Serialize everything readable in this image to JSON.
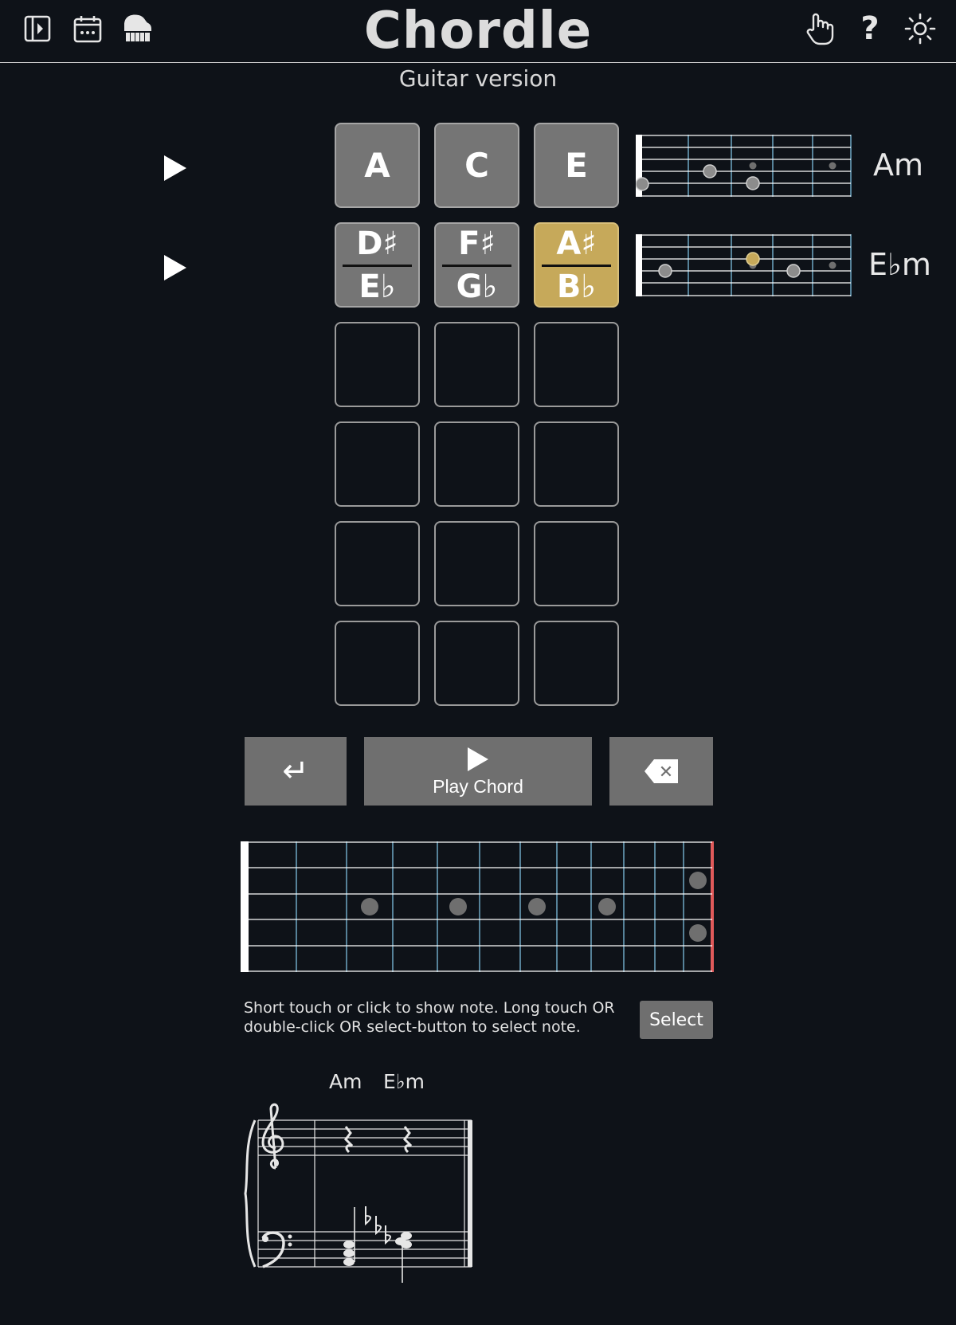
{
  "header": {
    "title": "Chordle",
    "subtitle": "Guitar version",
    "icons": [
      "sidebar-toggle-icon",
      "calendar-icon",
      "piano-icon",
      "touch-hand-icon",
      "help-icon",
      "brightness-icon"
    ],
    "help_glyph": "?"
  },
  "grid": {
    "rows": [
      {
        "tiles": [
          {
            "label": "A",
            "state": "gray"
          },
          {
            "label": "C",
            "state": "gray"
          },
          {
            "label": "E",
            "state": "gray"
          }
        ],
        "chord_name": "Am"
      },
      {
        "tiles": [
          {
            "top": "D♯",
            "bottom": "E♭",
            "state": "gray"
          },
          {
            "top": "F♯",
            "bottom": "G♭",
            "state": "gray"
          },
          {
            "top": "A♯",
            "bottom": "B♭",
            "state": "gold"
          }
        ],
        "chord_name": "E♭m"
      }
    ],
    "empty_rows": 4
  },
  "controls": {
    "enter_glyph": "↵",
    "play_label": "Play Chord",
    "delete_glyph": "✕"
  },
  "fretboard": {
    "hint": "Short touch or click to show note. Long touch OR double-click OR select-button to select note.",
    "select_label": "Select"
  },
  "score": {
    "chord_labels": [
      "Am",
      "E♭m"
    ]
  },
  "colors": {
    "background": "#0e1218",
    "tile_gray": "#757575",
    "tile_gold": "#c6a95a",
    "fret_blue": "#6fa7c4",
    "nut_red": "#e05a5a"
  }
}
